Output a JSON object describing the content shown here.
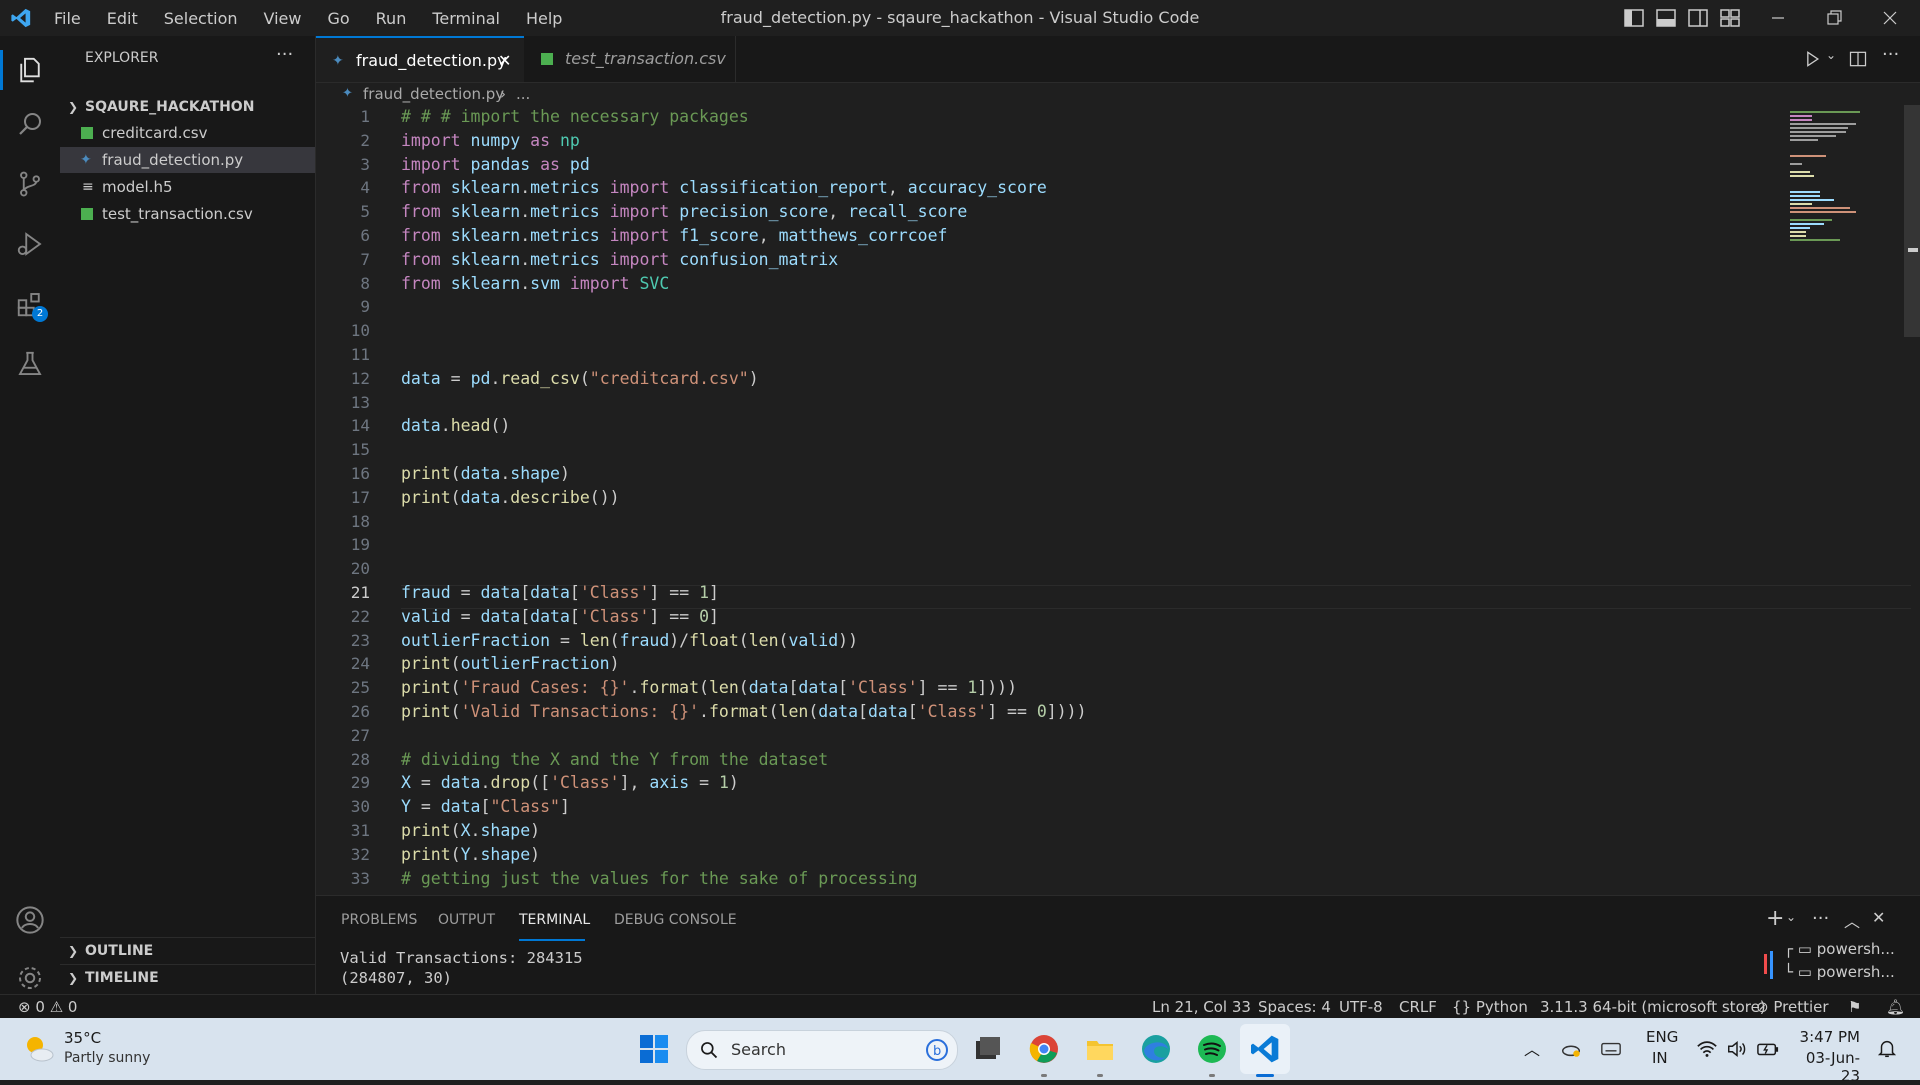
{
  "window": {
    "title": "fraud_detection.py - sqaure_hackathon - Visual Studio Code",
    "menu": [
      "File",
      "Edit",
      "Selection",
      "View",
      "Go",
      "Run",
      "Terminal",
      "Help"
    ]
  },
  "sidebar": {
    "header": "EXPLORER",
    "folder": "SQAURE_HACKATHON",
    "files": [
      "creditcard.csv",
      "fraud_detection.py",
      "model.h5",
      "test_transaction.csv"
    ],
    "outline": "OUTLINE",
    "timeline": "TIMELINE"
  },
  "activity": {
    "extensions_badge": "2"
  },
  "tabs": [
    {
      "label": "fraud_detection.py",
      "active": true
    },
    {
      "label": "test_transaction.csv",
      "active": false
    }
  ],
  "breadcrumb": {
    "file": "fraud_detection.py",
    "rest": "..."
  },
  "editor": {
    "line_numbers": [
      "1",
      "2",
      "3",
      "4",
      "5",
      "6",
      "7",
      "8",
      "9",
      "10",
      "11",
      "12",
      "13",
      "14",
      "15",
      "16",
      "17",
      "18",
      "19",
      "20",
      "21",
      "22",
      "23",
      "24",
      "25",
      "26",
      "27",
      "28",
      "29",
      "30",
      "31",
      "32",
      "33"
    ],
    "active_line": "21",
    "lines": [
      "# # # import the necessary packages",
      "import numpy as np",
      "import pandas as pd",
      "from sklearn.metrics import classification_report, accuracy_score",
      "from sklearn.metrics import precision_score, recall_score",
      "from sklearn.metrics import f1_score, matthews_corrcoef",
      "from sklearn.metrics import confusion_matrix",
      "from sklearn.svm import SVC",
      "",
      "",
      "",
      "data = pd.read_csv(\"creditcard.csv\")",
      "",
      "data.head()",
      "",
      "print(data.shape)",
      "print(data.describe())",
      "",
      "",
      "",
      "fraud = data[data['Class'] == 1]",
      "valid = data[data['Class'] == 0]",
      "outlierFraction = len(fraud)/float(len(valid))",
      "print(outlierFraction)",
      "print('Fraud Cases: {}'.format(len(data[data['Class'] == 1])))",
      "print('Valid Transactions: {}'.format(len(data[data['Class'] == 0])))",
      "",
      "# dividing the X and the Y from the dataset",
      "X = data.drop(['Class'], axis = 1)",
      "Y = data[\"Class\"]",
      "print(X.shape)",
      "print(Y.shape)",
      "# getting just the values for the sake of processing"
    ]
  },
  "panel": {
    "tabs": [
      "PROBLEMS",
      "OUTPUT",
      "TERMINAL",
      "DEBUG CONSOLE"
    ],
    "active_tab": "TERMINAL",
    "output": [
      "Valid Transactions: 284315",
      "(284807, 30)"
    ],
    "terminals": [
      "powersh...",
      "powersh..."
    ]
  },
  "status": {
    "errors": "0",
    "warnings": "0",
    "position": "Ln 21, Col 33",
    "spaces": "Spaces: 4",
    "encoding": "UTF-8",
    "eol": "CRLF",
    "language": "Python",
    "interpreter": "3.11.3 64-bit (microsoft store)",
    "formatter": "Prettier"
  },
  "taskbar": {
    "weather_temp": "35°C",
    "weather_desc": "Partly sunny",
    "search_placeholder": "Search",
    "lang_top": "ENG",
    "lang_bottom": "IN",
    "time": "3:47 PM",
    "date": "03-Jun-23"
  },
  "colors": {
    "accent": "#0078d4",
    "editor_bg": "#1f1f1f",
    "sidebar_bg": "#181818",
    "taskbar_bg": "#d8e3ee"
  }
}
